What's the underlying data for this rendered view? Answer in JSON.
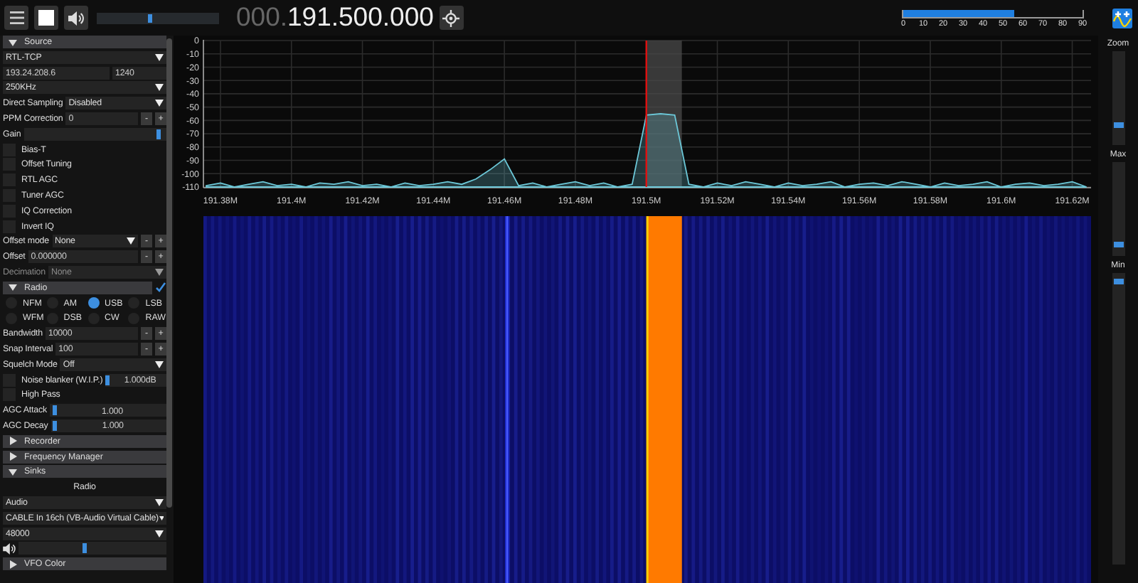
{
  "toolbar": {
    "volume": {
      "level": 0.43
    },
    "frequency": {
      "prefix": "000.",
      "value": "191.500.000"
    }
  },
  "snr_meter": {
    "level": 0.62,
    "ticks": [
      "0",
      "10",
      "20",
      "30",
      "40",
      "50",
      "60",
      "70",
      "80",
      "90"
    ]
  },
  "sidebar": {
    "rows": [
      {
        "kind": "header",
        "label": "Source",
        "expanded": true
      },
      {
        "kind": "select",
        "value": "RTL-TCP",
        "disabled": false
      },
      {
        "kind": "pair",
        "values": [
          "193.24.208.6",
          "1240"
        ]
      },
      {
        "kind": "select",
        "value": "250KHz",
        "disabled": false
      },
      {
        "kind": "select",
        "label": "Direct Sampling",
        "value": "Disabled",
        "disabled": false
      },
      {
        "kind": "number",
        "label": "PPM Correction",
        "value": "0",
        "buttons": [
          "-",
          "+"
        ]
      },
      {
        "kind": "slider",
        "label": "Gain",
        "level": 0.96
      },
      {
        "kind": "checkbox",
        "label": "Bias-T",
        "checked": false
      },
      {
        "kind": "checkbox",
        "label": "Offset Tuning",
        "checked": false
      },
      {
        "kind": "checkbox",
        "label": "RTL AGC",
        "checked": false
      },
      {
        "kind": "checkbox",
        "label": "Tuner AGC",
        "checked": false
      },
      {
        "kind": "checkbox",
        "label": "IQ Correction",
        "checked": false
      },
      {
        "kind": "checkbox",
        "label": "Invert IQ",
        "checked": false
      },
      {
        "kind": "select",
        "label": "Offset mode",
        "value": "None",
        "disabled": false,
        "buttons": [
          "-",
          "+"
        ]
      },
      {
        "kind": "number",
        "label": "Offset",
        "value": "0.000000",
        "buttons": [
          "-",
          "+"
        ]
      },
      {
        "kind": "select",
        "label": "Decimation",
        "value": "None",
        "disabled": true
      },
      {
        "kind": "header",
        "label": "Radio",
        "expanded": true,
        "checked": true
      },
      {
        "kind": "radios",
        "options": [
          {
            "label": "NFM",
            "selected": false
          },
          {
            "label": "AM",
            "selected": false
          },
          {
            "label": "USB",
            "selected": true
          },
          {
            "label": "LSB",
            "selected": false
          }
        ]
      },
      {
        "kind": "radios",
        "options": [
          {
            "label": "WFM",
            "selected": false
          },
          {
            "label": "DSB",
            "selected": false
          },
          {
            "label": "CW",
            "selected": false
          },
          {
            "label": "RAW",
            "selected": false
          }
        ]
      },
      {
        "kind": "number",
        "label": "Bandwidth",
        "value": "10000",
        "buttons": [
          "-",
          "+"
        ]
      },
      {
        "kind": "number",
        "label": "Snap Interval",
        "value": "100",
        "buttons": [
          "-",
          "+"
        ]
      },
      {
        "kind": "select",
        "label": "Squelch Mode",
        "value": "Off",
        "disabled": false
      },
      {
        "kind": "check-slider",
        "label": "Noise blanker (W.I.P.)",
        "checked": false,
        "level": 0.0,
        "reading": "1.000dB"
      },
      {
        "kind": "checkbox",
        "label": "High Pass",
        "checked": false
      },
      {
        "kind": "slider",
        "label": "AGC Attack",
        "level": 0.02,
        "reading": "1.000"
      },
      {
        "kind": "slider",
        "label": "AGC Decay",
        "level": 0.02,
        "reading": "1.000"
      },
      {
        "kind": "header",
        "label": "Recorder",
        "expanded": false
      },
      {
        "kind": "header",
        "label": "Frequency Manager",
        "expanded": false
      },
      {
        "kind": "header",
        "label": "Sinks",
        "expanded": true
      },
      {
        "kind": "caption",
        "label": "Radio"
      },
      {
        "kind": "select",
        "value": "Audio",
        "disabled": false
      },
      {
        "kind": "select",
        "value": "CABLE In 16ch (VB-Audio Virtual Cable)",
        "disabled": false
      },
      {
        "kind": "select",
        "value": "48000",
        "disabled": false
      },
      {
        "kind": "volume",
        "level": 0.45
      },
      {
        "kind": "header",
        "label": "VFO Color",
        "expanded": false
      }
    ]
  },
  "spectrum": {
    "chart_data": {
      "type": "area",
      "xlim": [
        191.3752,
        191.6253
      ],
      "ylim": [
        -110,
        0
      ],
      "grid": true,
      "bands": [
        {
          "axis": "x",
          "from": 191.5,
          "to": 191.51,
          "color": "#4a4a4a"
        }
      ],
      "ref_lines": [
        {
          "axis": "x",
          "value": 191.5,
          "color": "#e01010"
        }
      ],
      "yticks": [
        0,
        -10,
        -20,
        -30,
        -40,
        -50,
        -60,
        -70,
        -80,
        -90,
        -100,
        -110
      ],
      "xticks": [
        {
          "value": 191.38,
          "label": "191.38M"
        },
        {
          "value": 191.4,
          "label": "191.4M"
        },
        {
          "value": 191.42,
          "label": "191.42M"
        },
        {
          "value": 191.44,
          "label": "191.44M"
        },
        {
          "value": 191.46,
          "label": "191.46M"
        },
        {
          "value": 191.48,
          "label": "191.48M"
        },
        {
          "value": 191.5,
          "label": "191.5M"
        },
        {
          "value": 191.52,
          "label": "191.52M"
        },
        {
          "value": 191.54,
          "label": "191.54M"
        },
        {
          "value": 191.56,
          "label": "191.56M"
        },
        {
          "value": 191.58,
          "label": "191.58M"
        },
        {
          "value": 191.6,
          "label": "191.6M"
        },
        {
          "value": 191.62,
          "label": "191.62M"
        }
      ],
      "x": [
        191.376,
        191.38,
        191.384,
        191.388,
        191.392,
        191.396,
        191.4,
        191.404,
        191.408,
        191.412,
        191.416,
        191.42,
        191.424,
        191.428,
        191.432,
        191.436,
        191.44,
        191.444,
        191.448,
        191.452,
        191.456,
        191.46,
        191.464,
        191.468,
        191.472,
        191.476,
        191.48,
        191.484,
        191.488,
        191.492,
        191.496,
        191.5,
        191.504,
        191.508,
        191.512,
        191.516,
        191.52,
        191.524,
        191.528,
        191.532,
        191.536,
        191.54,
        191.544,
        191.548,
        191.552,
        191.556,
        191.56,
        191.564,
        191.568,
        191.572,
        191.576,
        191.58,
        191.584,
        191.588,
        191.592,
        191.596,
        191.6,
        191.604,
        191.608,
        191.612,
        191.616,
        191.62,
        191.624
      ],
      "series": [
        {
          "color": "#6cc8d8",
          "values": [
            -109,
            -107,
            -110,
            -108,
            -106,
            -109,
            -108,
            -110,
            -107,
            -108,
            -106,
            -109,
            -108,
            -110,
            -107,
            -109,
            -108,
            -106,
            -108,
            -104,
            -97,
            -89,
            -109,
            -107,
            -110,
            -108,
            -106,
            -109,
            -107,
            -110,
            -108,
            -56,
            -55,
            -56,
            -108,
            -110,
            -107,
            -109,
            -106,
            -108,
            -110,
            -107,
            -109,
            -108,
            -106,
            -110,
            -108,
            -107,
            -109,
            -106,
            -108,
            -110,
            -107,
            -109,
            -108,
            -106,
            -110,
            -108,
            -107,
            -109,
            -108,
            -106,
            -110
          ]
        }
      ]
    }
  },
  "zoom_sliders": [
    {
      "label": "Zoom",
      "level": 0.2
    },
    {
      "label": "Max",
      "level": 0.1
    },
    {
      "label": "Min",
      "level": 0.98
    }
  ]
}
